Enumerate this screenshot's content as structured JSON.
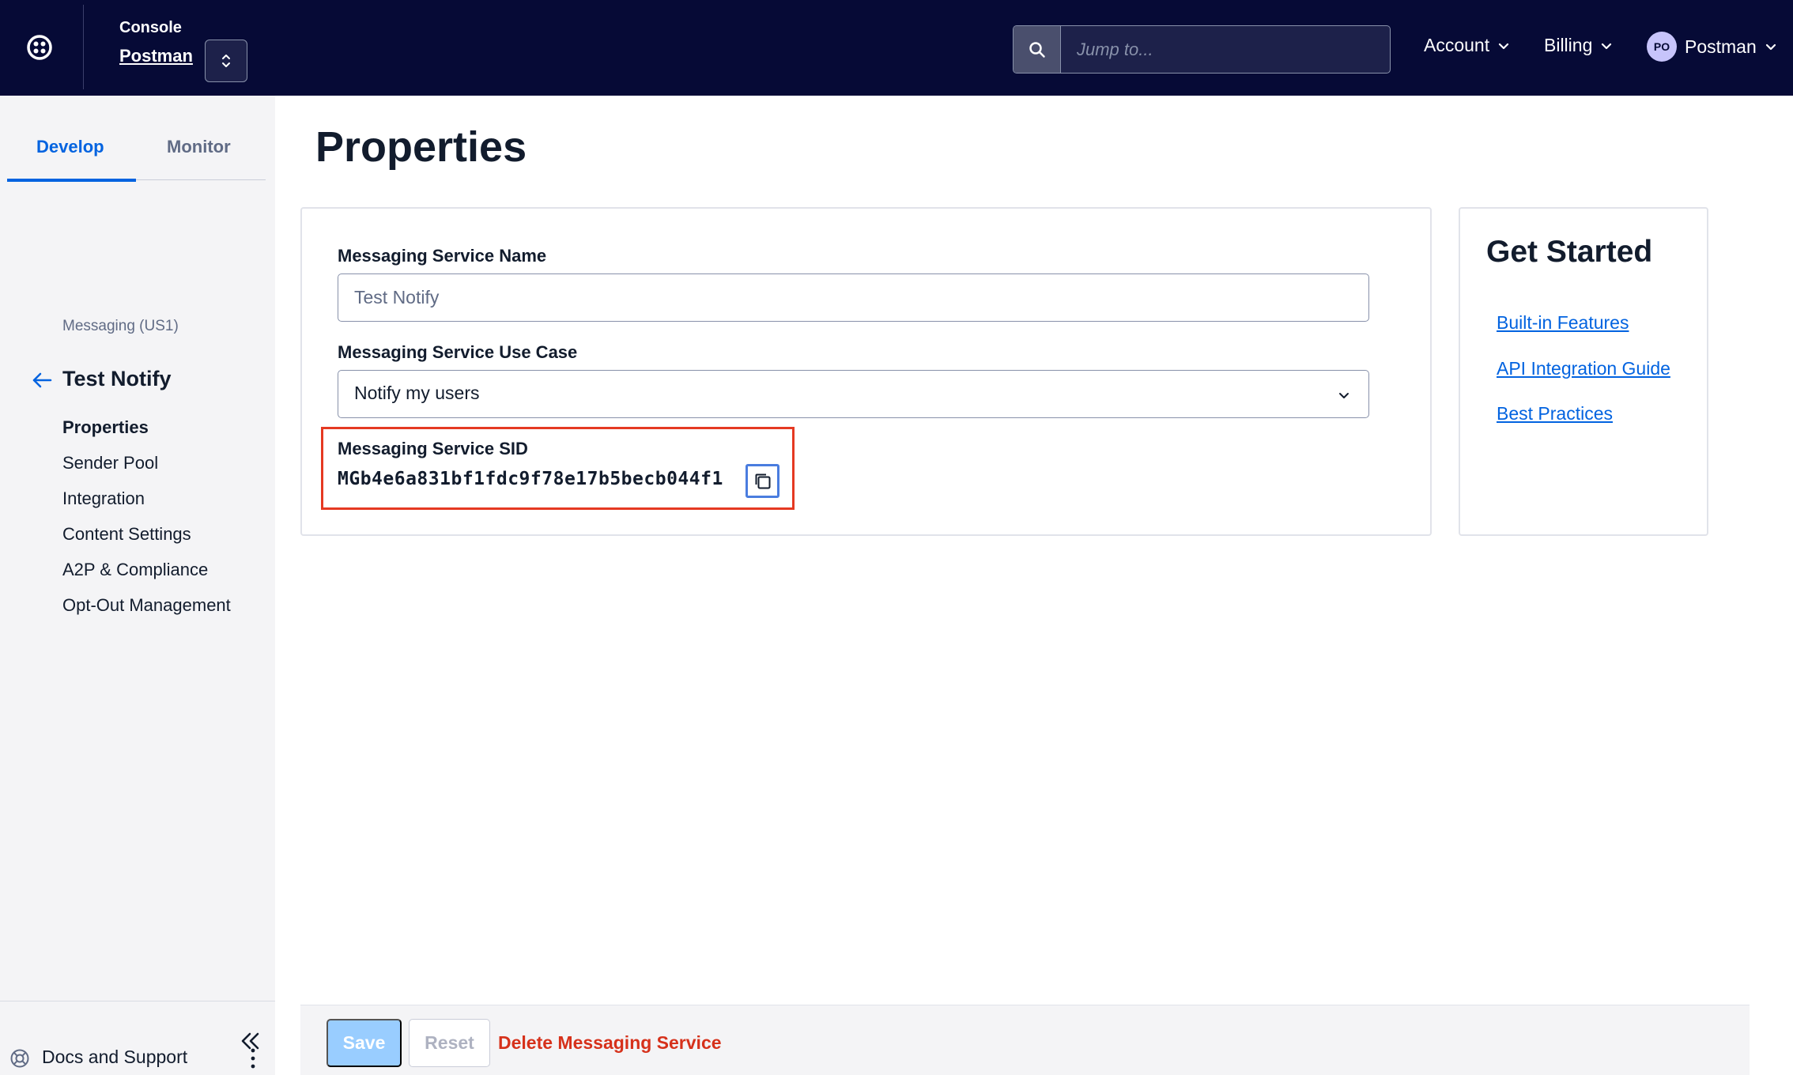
{
  "topbar": {
    "console_label": "Console",
    "account_name": "Postman",
    "search_placeholder": "Jump to...",
    "menus": [
      {
        "label": "Account"
      },
      {
        "label": "Billing"
      }
    ],
    "user": {
      "initials": "PO",
      "name": "Postman"
    }
  },
  "sidebar": {
    "tabs": [
      {
        "label": "Develop",
        "active": true
      },
      {
        "label": "Monitor",
        "active": false
      }
    ],
    "breadcrumb": "Messaging (US1)",
    "service_title": "Test Notify",
    "nav_items": [
      {
        "label": "Properties",
        "active": true
      },
      {
        "label": "Sender Pool"
      },
      {
        "label": "Integration"
      },
      {
        "label": "Content Settings"
      },
      {
        "label": "A2P & Compliance"
      },
      {
        "label": "Opt-Out Management"
      }
    ],
    "docs_label": "Docs and Support"
  },
  "main": {
    "page_title": "Properties",
    "service_name_label": "Messaging Service Name",
    "service_name_placeholder": "Test Notify",
    "use_case_label": "Messaging Service Use Case",
    "use_case_value": "Notify my users",
    "sid_label": "Messaging Service SID",
    "sid_value": "MGb4e6a831bf1fdc9f78e17b5becb044f1"
  },
  "get_started": {
    "title": "Get Started",
    "links": [
      "Built-in Features",
      "API Integration Guide",
      "Best Practices"
    ]
  },
  "footer": {
    "save_label": "Save",
    "reset_label": "Reset",
    "delete_label": "Delete Messaging Service"
  },
  "colors": {
    "topbar_bg": "#060a36",
    "accent_blue": "#0263e0",
    "highlight_red": "#e53922",
    "delete_red": "#d6311b"
  }
}
